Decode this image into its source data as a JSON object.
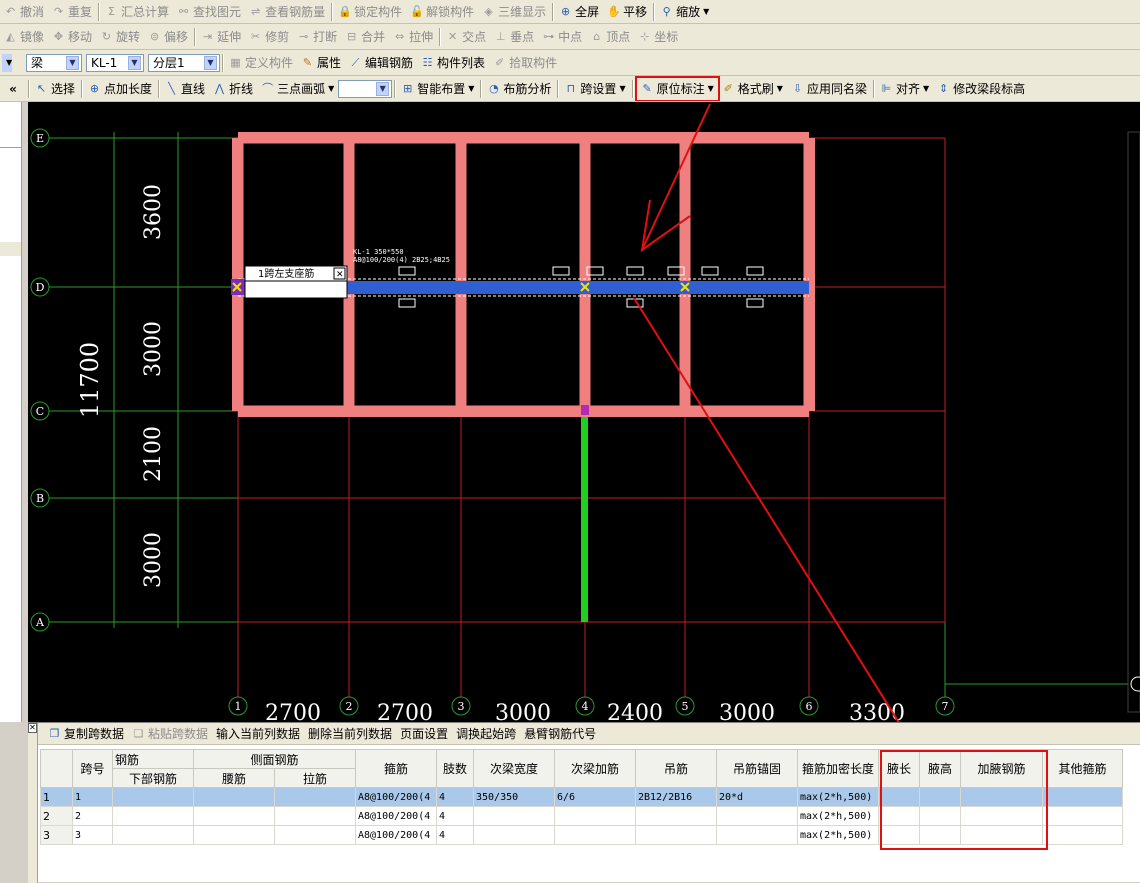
{
  "toolbar1": [
    {
      "label": "撤消",
      "icon": "undo-icon",
      "enabled": false
    },
    {
      "label": "重复",
      "icon": "redo-icon",
      "enabled": false
    },
    {
      "label": "汇总计算",
      "icon": "sum-icon",
      "enabled": false
    },
    {
      "label": "查找图元",
      "icon": "binoculars-icon",
      "enabled": false
    },
    {
      "label": "查看钢筋量",
      "icon": "view-rebar-icon",
      "enabled": false
    },
    {
      "label": "锁定构件",
      "icon": "lock-icon",
      "enabled": false
    },
    {
      "label": "解锁构件",
      "icon": "unlock-icon",
      "enabled": false
    },
    {
      "label": "三维显示",
      "icon": "3d-icon",
      "enabled": false
    },
    {
      "label": "全屏",
      "icon": "fullscreen-icon",
      "enabled": true
    },
    {
      "label": "平移",
      "icon": "pan-hand-icon",
      "enabled": true
    },
    {
      "label": "缩放",
      "icon": "zoom-icon",
      "enabled": true
    }
  ],
  "toolbar2": [
    "镜像",
    "移动",
    "旋转",
    "偏移",
    "延伸",
    "修剪",
    "打断",
    "合并",
    "拉伸",
    "交点",
    "垂点",
    "中点",
    "顶点",
    "坐标"
  ],
  "toolbar3": {
    "type_value": "梁",
    "name_value": "KL-1",
    "floor_value": "分层1",
    "define": "定义构件",
    "attributes": "属性",
    "edit_rebar": "编辑钢筋",
    "component_list": "构件列表",
    "pick": "拾取构件"
  },
  "toolbar4": {
    "select": "选择",
    "point_len": "点加长度",
    "line": "直线",
    "polyline": "折线",
    "arc": "三点画弧",
    "smart": "智能布置",
    "layout_analysis": "布筋分析",
    "span_setting": "跨设置",
    "in_place": "原位标注",
    "format_brush": "格式刷",
    "apply_same": "应用同名梁",
    "align": "对齐",
    "modify_height": "修改梁段标高"
  },
  "cad": {
    "row_axes": [
      "E",
      "D",
      "C",
      "B",
      "A"
    ],
    "col_axes": [
      "1",
      "2",
      "3",
      "4",
      "5",
      "6",
      "7"
    ],
    "row_dims": [
      "3600",
      "3000",
      "2100",
      "3000"
    ],
    "total_dim": "11700",
    "col_dims": [
      "2700",
      "2700",
      "3000",
      "2400",
      "3000",
      "3300"
    ],
    "beam_label_1": "KL-1 350*550",
    "beam_label_2": "A8@100/200(4) 2B25;4B25",
    "input_popup": "1跨左支座筋"
  },
  "bottom_toolbar": {
    "copy": "复制跨数据",
    "paste": "粘贴跨数据",
    "input_col": "输入当前列数据",
    "delete_col": "删除当前列数据",
    "page_setup": "页面设置",
    "swap": "调换起始跨",
    "cantilever": "悬臂钢筋代号"
  },
  "table": {
    "headers_top": {
      "span": "跨号",
      "rebar": "钢筋",
      "side_rebar": "侧面钢筋",
      "stirrup": "箍筋",
      "legs": "肢数",
      "sec_width": "次梁宽度",
      "sec_add": "次梁加筋",
      "hanger": "吊筋",
      "hanger_anchor": "吊筋锚固",
      "dense_len": "箍筋加密长度",
      "haunch_len": "腋长",
      "haunch_h": "腋高",
      "haunch_rebar": "加腋钢筋",
      "other": "其他箍筋"
    },
    "headers_sub": {
      "bottom": "下部钢筋",
      "waist": "腰筋",
      "tie": "拉筋"
    },
    "rows": [
      {
        "num": "1",
        "span": "1",
        "stirrup": "A8@100/200(4",
        "legs": "4",
        "sec_width": "350/350",
        "sec_add": "6/6",
        "hanger": "2B12/2B16",
        "anchor": "20*d",
        "dense": "max(2*h,500)"
      },
      {
        "num": "2",
        "span": "2",
        "stirrup": "A8@100/200(4",
        "legs": "4",
        "sec_width": "",
        "sec_add": "",
        "hanger": "",
        "anchor": "",
        "dense": "max(2*h,500)"
      },
      {
        "num": "3",
        "span": "3",
        "stirrup": "A8@100/200(4",
        "legs": "4",
        "sec_width": "",
        "sec_add": "",
        "hanger": "",
        "anchor": "",
        "dense": "max(2*h,500)"
      }
    ]
  },
  "colors": {
    "annotation_red": "#e01010",
    "beam_pink": "#f08080",
    "selected_beam": "#2f5fd0",
    "column_green": "#20d020",
    "grid_green": "#2a9a2a",
    "grid_red": "#c02020"
  }
}
